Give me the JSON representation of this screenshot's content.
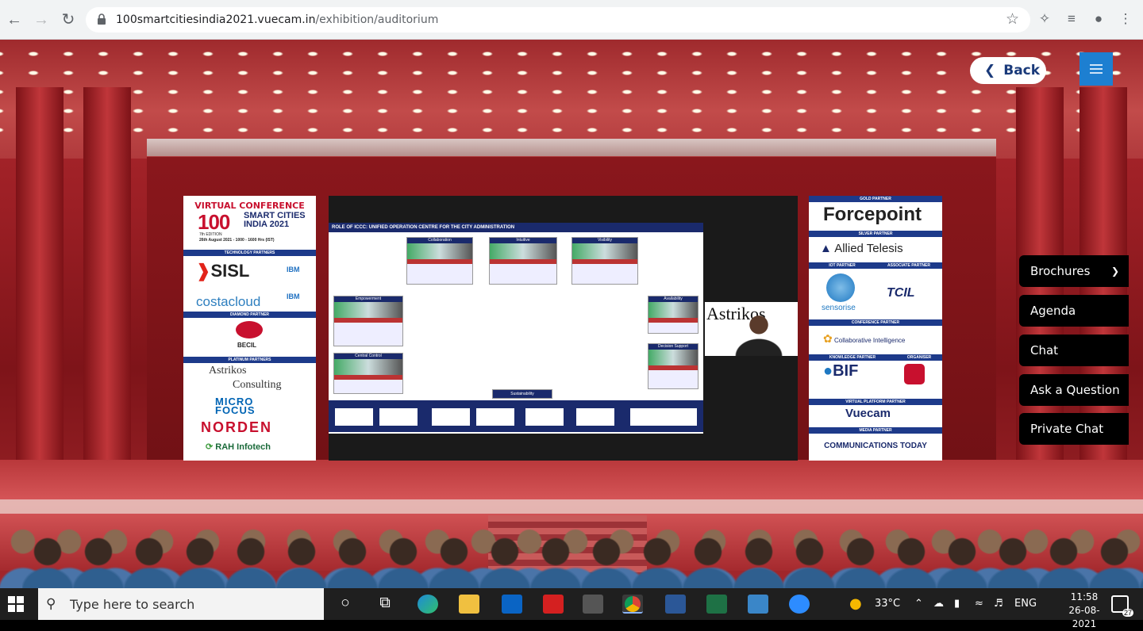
{
  "browser": {
    "url_host": "100smartcitiesindia2021.vuecam.in",
    "url_path": "/exhibition/auditorium"
  },
  "overlay": {
    "back_label": "Back",
    "side_menu": [
      {
        "label": "Brochures",
        "has_dropdown": true
      },
      {
        "label": "Agenda"
      },
      {
        "label": "Chat"
      },
      {
        "label": "Ask a Question"
      },
      {
        "label": "Private Chat"
      }
    ]
  },
  "left_panel": {
    "heading": "VIRTUAL CONFERENCE",
    "number": "100",
    "event": "SMART CITIES INDIA 2021",
    "edition": "7th EDITION",
    "date": "26th August 2021 - 1000 - 1600 Hrs (IST)",
    "bands": [
      "TECHNOLOGY PARTNERS",
      "DIAMOND PARTNER",
      "PLATINUM PARTNERS"
    ],
    "logos": [
      "SISL",
      "IBM",
      "costacloud",
      "IBM",
      "BECIL",
      "Astrikos",
      "Consulting",
      "MICRO FOCUS",
      "NORDEN",
      "RAH Infotech"
    ]
  },
  "right_panel": {
    "bands": [
      "GOLD PARTNER",
      "SILVER PARTNER",
      "IOT PARTNER",
      "ASSOCIATE PARTNER",
      "CONFERENCE PARTNER",
      "KNOWLEDGE PARTNER",
      "ORGANISER",
      "VIRTUAL PLATFORM PARTNER",
      "MEDIA PARTNER"
    ],
    "logos": [
      "Forcepoint",
      "Allied Telesis",
      "sensorise",
      "TCIL",
      "Collaborative Intelligence",
      "BIF",
      "Vuecam",
      "COMMUNICATIONS TODAY"
    ]
  },
  "screen": {
    "slide_title": "ROLE OF ICCC: UNIFIED OPERATION CENTRE FOR THE CITY ADMINISTRATION",
    "boxes": [
      "Collaboration",
      "Intuitive",
      "Visibility",
      "Empowerment",
      "Availability",
      "Central Control",
      "Decision Support",
      "Sustainability"
    ],
    "speaker_brand": "Astrikos"
  },
  "taskbar": {
    "search_placeholder": "Type here to search",
    "weather": "33°C",
    "lang": "ENG",
    "time": "11:58",
    "date": "26-08-2021",
    "notifications": "27"
  }
}
